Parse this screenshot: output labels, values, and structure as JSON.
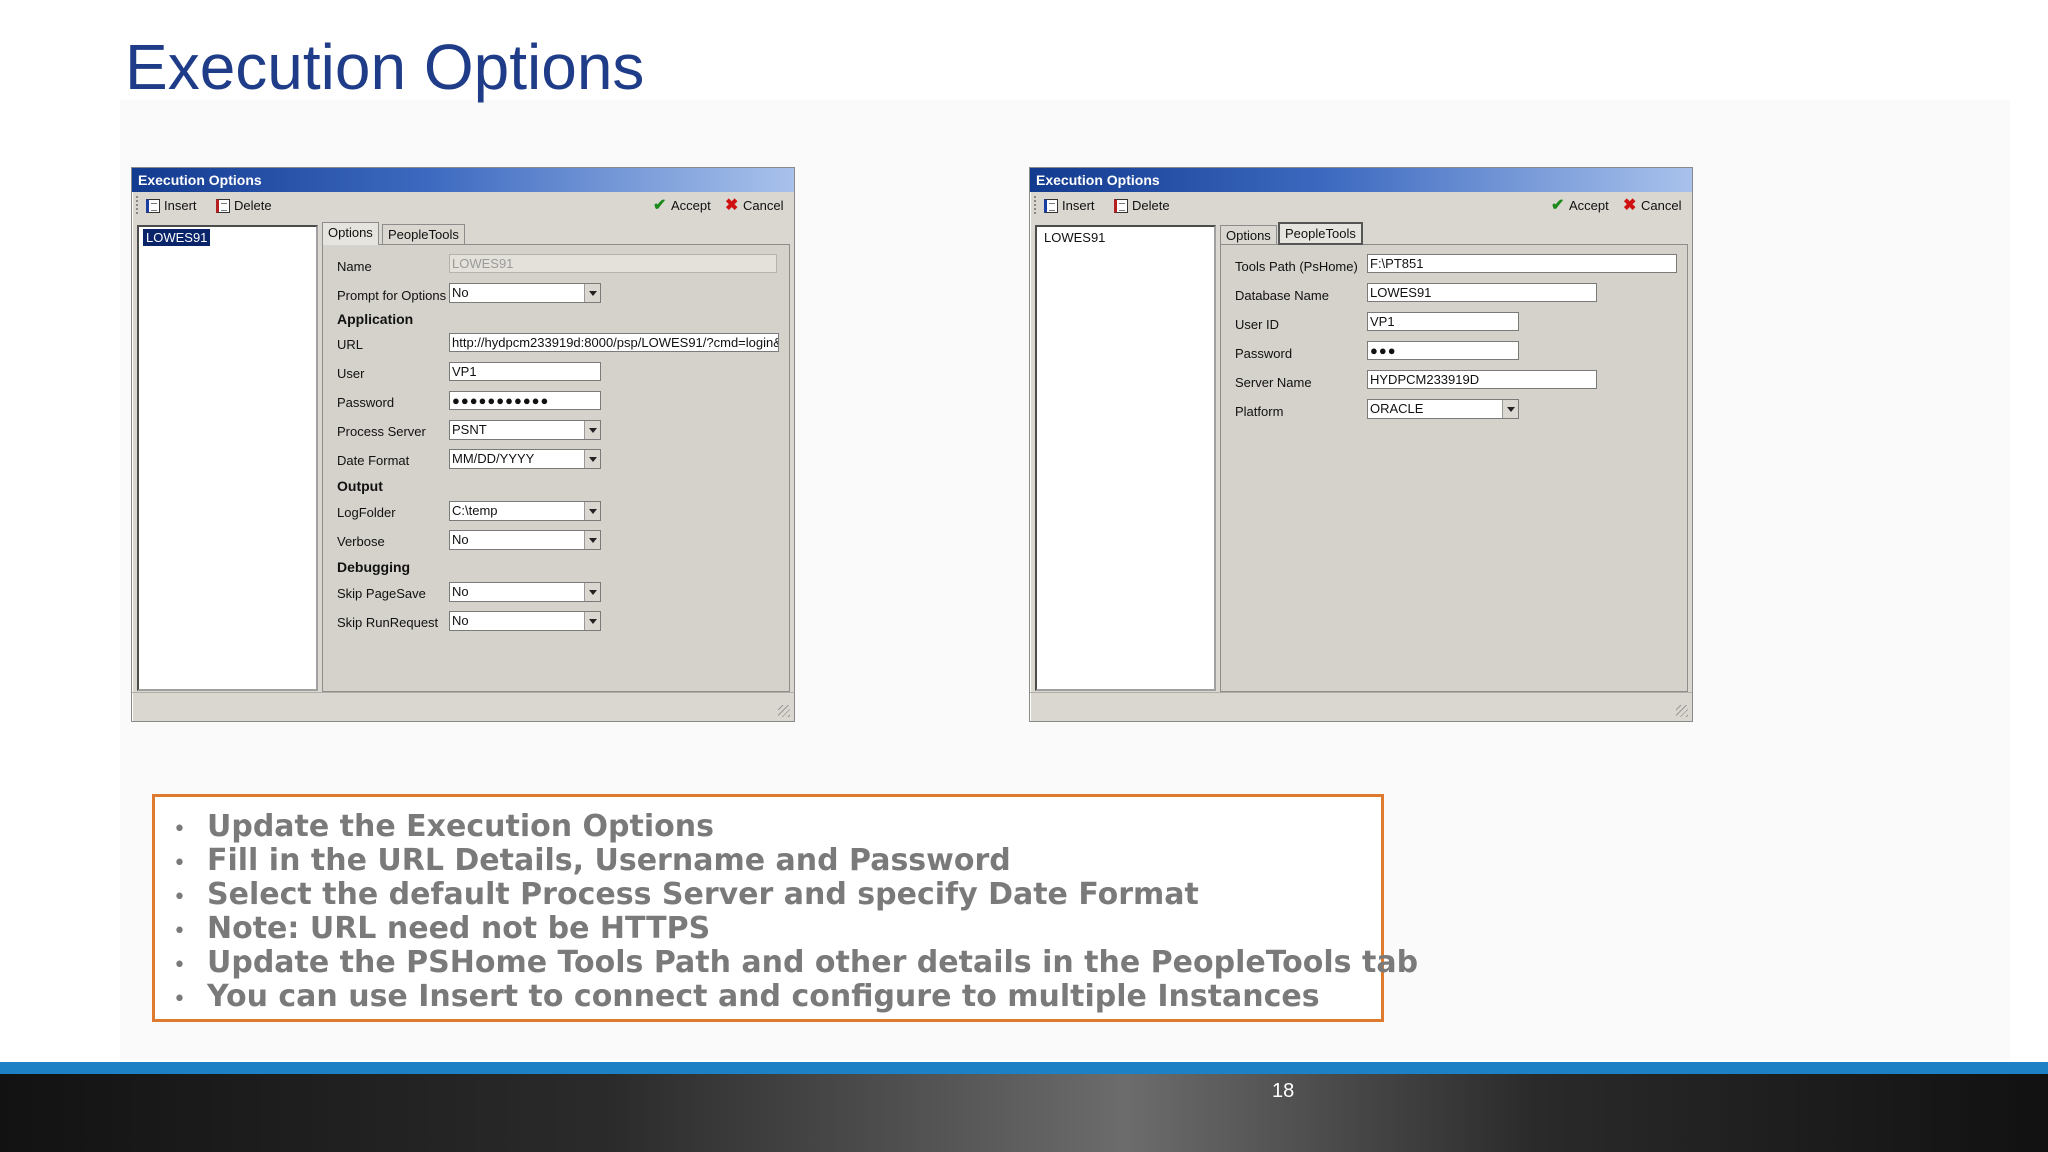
{
  "slide": {
    "title": "Execution Options",
    "page_number": "18"
  },
  "dialog_left": {
    "window_title": "Execution Options",
    "toolbar": {
      "insert": "Insert",
      "delete": "Delete",
      "accept": "Accept",
      "cancel": "Cancel"
    },
    "list_items": [
      "LOWES91"
    ],
    "tabs": [
      "Options",
      "PeopleTools"
    ],
    "active_tab": "Options",
    "fields": {
      "name_label": "Name",
      "name_value": "LOWES91",
      "prompt_label": "Prompt for Options",
      "prompt_value": "No",
      "application_header": "Application",
      "url_label": "URL",
      "url_value": "http://hydpcm233919d:8000/psp/LOWES91/?cmd=login&",
      "user_label": "User",
      "user_value": "VP1",
      "password_label": "Password",
      "password_value": "●●●●●●●●●●●",
      "process_server_label": "Process Server",
      "process_server_value": "PSNT",
      "date_format_label": "Date Format",
      "date_format_value": "MM/DD/YYYY",
      "output_header": "Output",
      "logfolder_label": "LogFolder",
      "logfolder_value": "C:\\temp",
      "verbose_label": "Verbose",
      "verbose_value": "No",
      "debugging_header": "Debugging",
      "skip_pagesave_label": "Skip PageSave",
      "skip_pagesave_value": "No",
      "skip_runrequest_label": "Skip RunRequest",
      "skip_runrequest_value": "No"
    }
  },
  "dialog_right": {
    "window_title": "Execution Options",
    "toolbar": {
      "insert": "Insert",
      "delete": "Delete",
      "accept": "Accept",
      "cancel": "Cancel"
    },
    "list_items": [
      "LOWES91"
    ],
    "tabs": [
      "Options",
      "PeopleTools"
    ],
    "active_tab": "PeopleTools",
    "fields": {
      "tools_path_label": "Tools Path (PsHome)",
      "tools_path_value": "F:\\PT851",
      "database_name_label": "Database Name",
      "database_name_value": "LOWES91",
      "user_id_label": "User ID",
      "user_id_value": "VP1",
      "password_label": "Password",
      "password_value": "●●●",
      "server_name_label": "Server Name",
      "server_name_value": "HYDPCM233919D",
      "platform_label": "Platform",
      "platform_value": "ORACLE"
    }
  },
  "bullets": [
    "Update the Execution Options",
    "Fill in the URL Details, Username and Password",
    "Select the default Process Server and specify Date Format",
    "Note: URL need not be HTTPS",
    "Update the PSHome Tools Path and other details in the PeopleTools tab",
    "You can use Insert to connect and configure to multiple Instances"
  ],
  "bullet_char": "•",
  "colors": {
    "title": "#1f3c88",
    "bullet_border": "#e07a2e",
    "footer_blue": "#1d82c5",
    "selection": "#0a246a"
  }
}
